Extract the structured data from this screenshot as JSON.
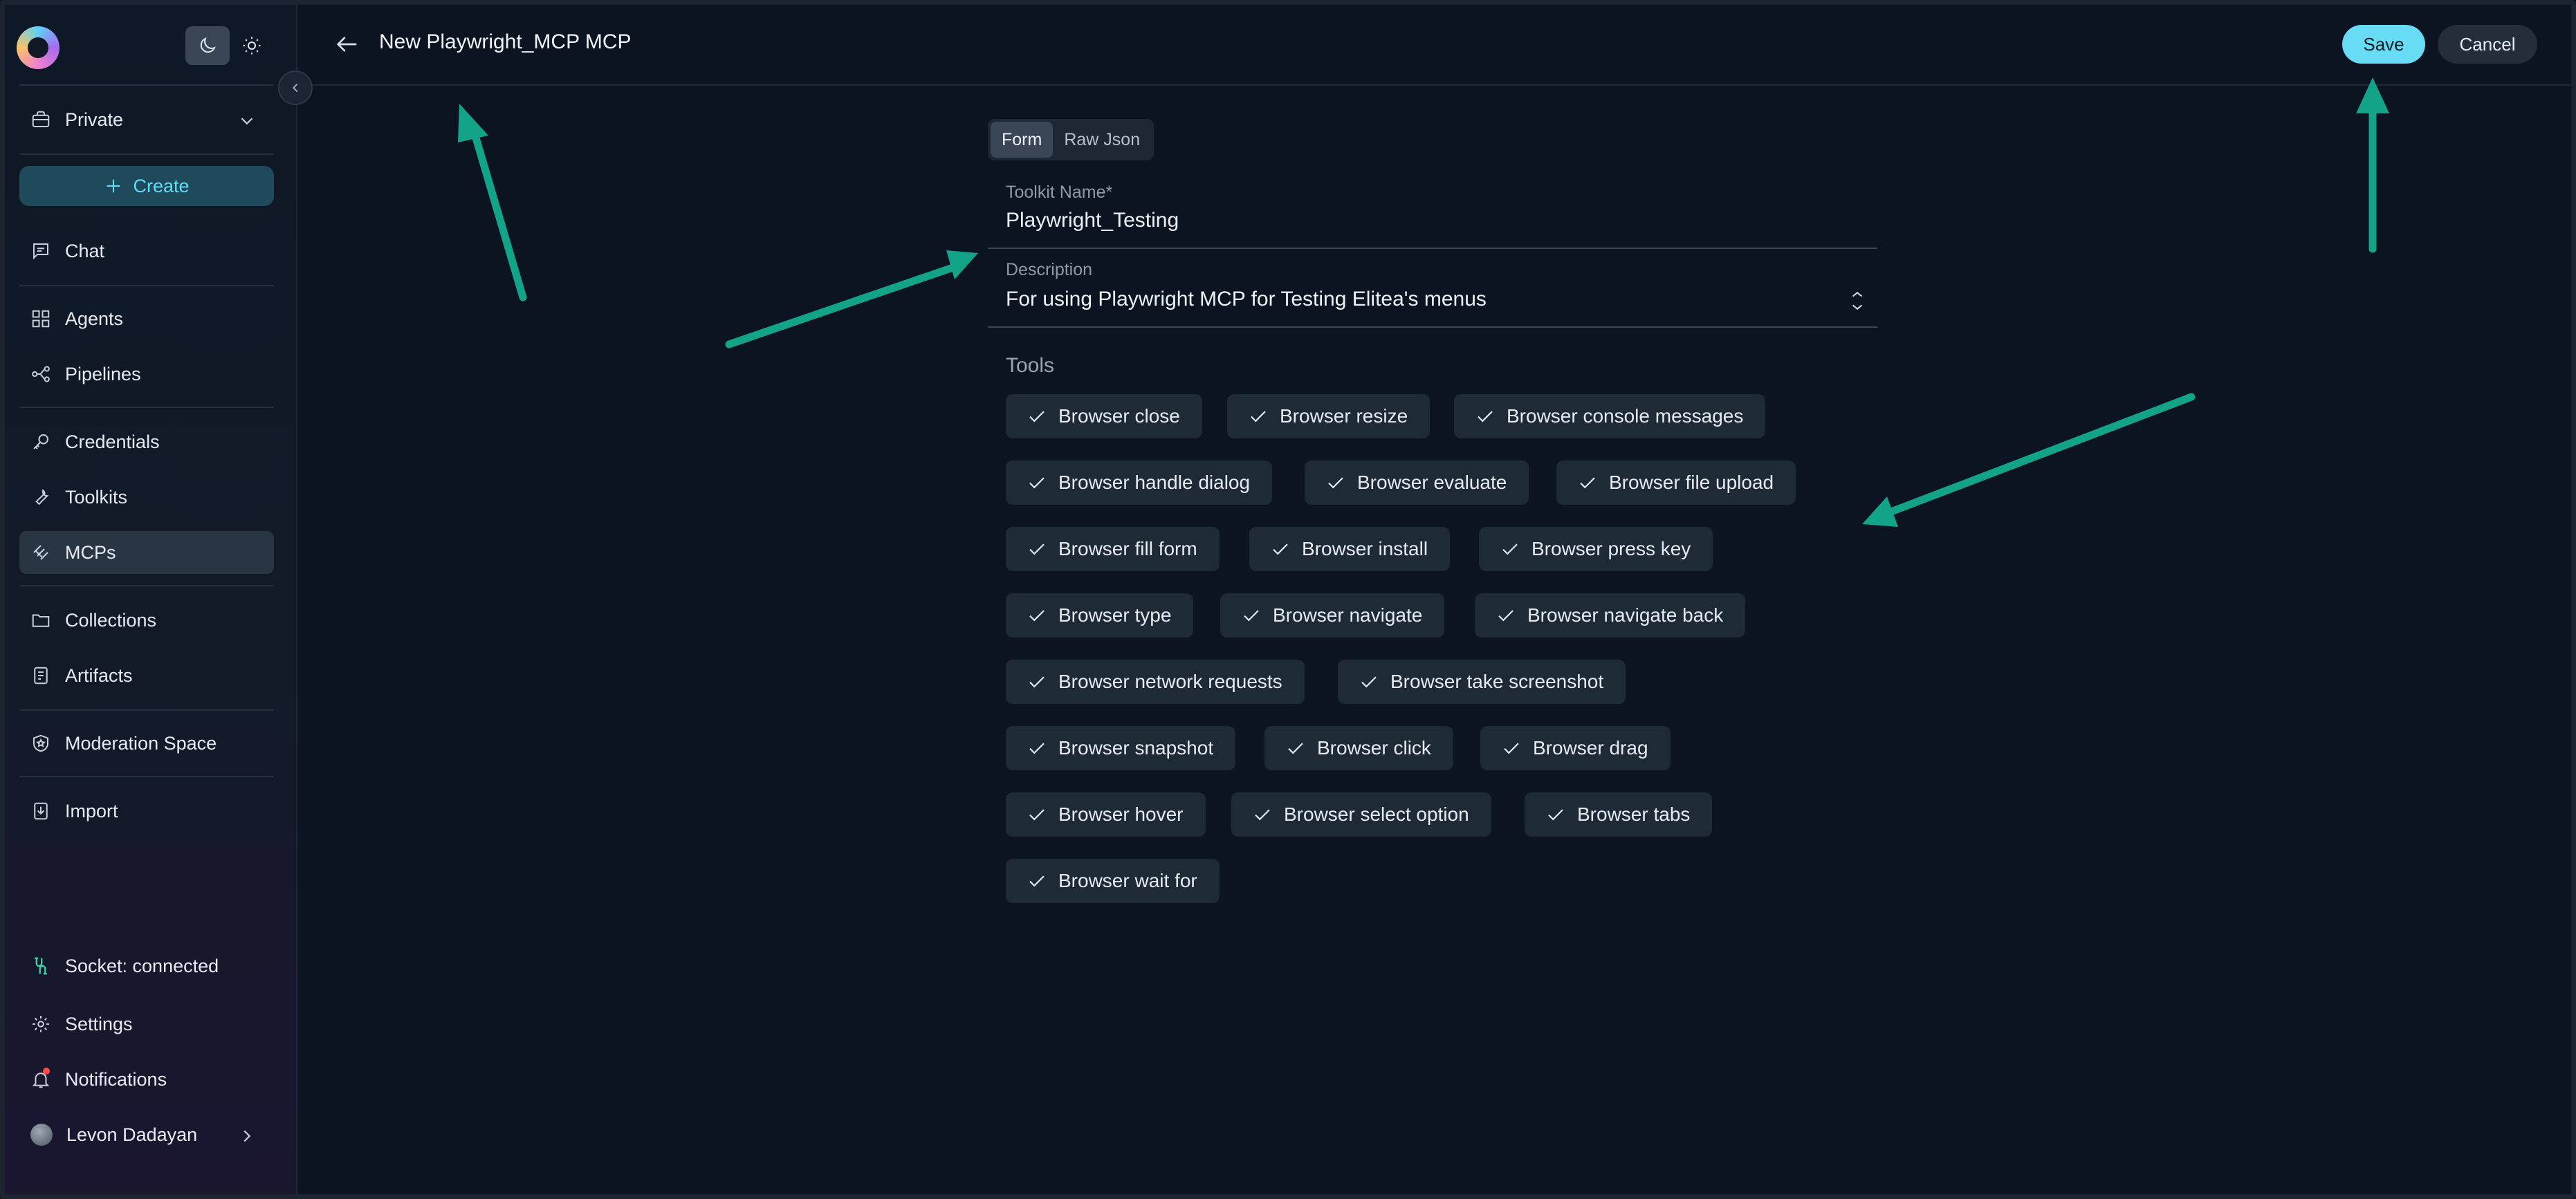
{
  "sidebar": {
    "project": "Private",
    "create_label": "Create",
    "items": [
      {
        "label": "Chat"
      },
      {
        "label": "Agents"
      },
      {
        "label": "Pipelines"
      },
      {
        "label": "Credentials"
      },
      {
        "label": "Toolkits"
      },
      {
        "label": "MCPs"
      },
      {
        "label": "Collections"
      },
      {
        "label": "Artifacts"
      },
      {
        "label": "Moderation Space"
      },
      {
        "label": "Import"
      }
    ],
    "active_item": "MCPs",
    "socket_status": "Socket: connected",
    "settings_label": "Settings",
    "notifications_label": "Notifications",
    "user_name": "Levon Dadayan"
  },
  "header": {
    "title": "New Playwright_MCP MCP",
    "save_label": "Save",
    "cancel_label": "Cancel"
  },
  "form": {
    "tabs": [
      "Form",
      "Raw Json"
    ],
    "active_tab": "Form",
    "toolkit_name_label": "Toolkit Name",
    "toolkit_name_required": "*",
    "toolkit_name_value": "Playwright_Testing",
    "description_label": "Description",
    "description_value": "For using Playwright MCP for Testing Elitea's menus",
    "tools_label": "Tools",
    "tools": [
      {
        "label": "Browser close",
        "checked": true
      },
      {
        "label": "Browser resize",
        "checked": true
      },
      {
        "label": "Browser console messages",
        "checked": true
      },
      {
        "label": "Browser handle dialog",
        "checked": true
      },
      {
        "label": "Browser evaluate",
        "checked": true
      },
      {
        "label": "Browser file upload",
        "checked": true
      },
      {
        "label": "Browser fill form",
        "checked": true
      },
      {
        "label": "Browser install",
        "checked": true
      },
      {
        "label": "Browser press key",
        "checked": true
      },
      {
        "label": "Browser type",
        "checked": true
      },
      {
        "label": "Browser navigate",
        "checked": true
      },
      {
        "label": "Browser navigate back",
        "checked": true
      },
      {
        "label": "Browser network requests",
        "checked": true
      },
      {
        "label": "Browser take screenshot",
        "checked": true
      },
      {
        "label": "Browser snapshot",
        "checked": true
      },
      {
        "label": "Browser click",
        "checked": true
      },
      {
        "label": "Browser drag",
        "checked": true
      },
      {
        "label": "Browser hover",
        "checked": true
      },
      {
        "label": "Browser select option",
        "checked": true
      },
      {
        "label": "Browser tabs",
        "checked": true
      },
      {
        "label": "Browser wait for",
        "checked": true
      }
    ]
  },
  "colors": {
    "accent": "#68dcf5",
    "annotation_arrow": "#13a388",
    "background": "#0b1420"
  }
}
